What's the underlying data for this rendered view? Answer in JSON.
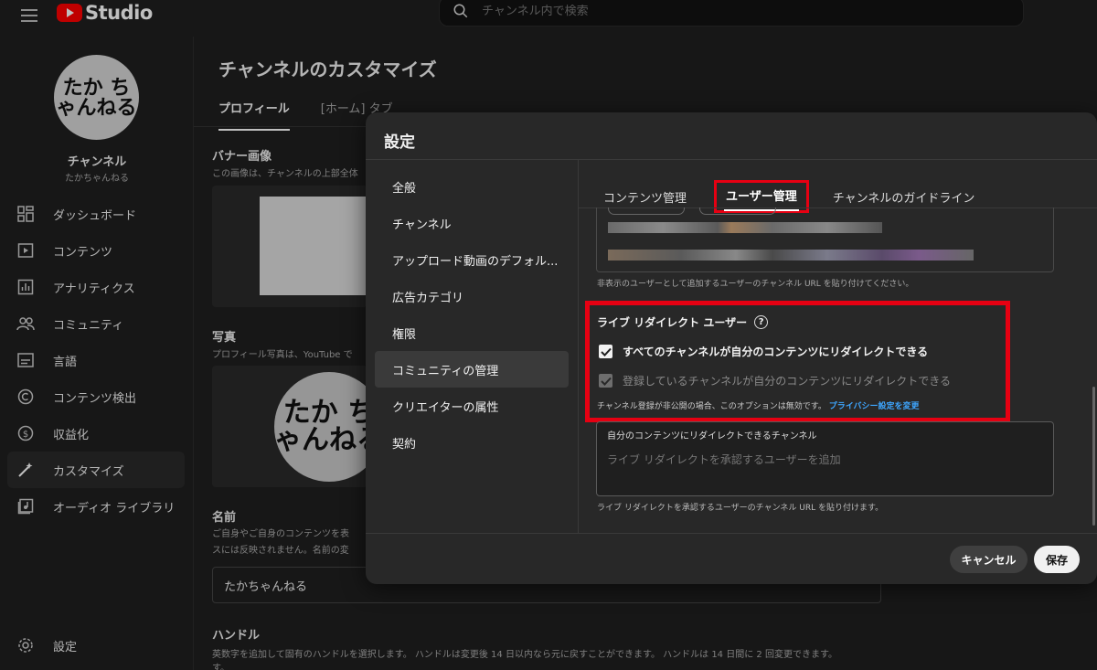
{
  "app": {
    "logo_text": "Studio",
    "search_placeholder": "チャンネル内で検索"
  },
  "sidebar": {
    "avatar_text": "たか ちゃんねる",
    "channel_title": "チャンネル",
    "channel_name": "たかちゃんねる",
    "items": [
      {
        "label": "ダッシュボード",
        "icon": "dashboard-icon"
      },
      {
        "label": "コンテンツ",
        "icon": "content-icon"
      },
      {
        "label": "アナリティクス",
        "icon": "analytics-icon"
      },
      {
        "label": "コミュニティ",
        "icon": "community-icon"
      },
      {
        "label": "言語",
        "icon": "subtitles-icon"
      },
      {
        "label": "コンテンツ検出",
        "icon": "copyright-icon"
      },
      {
        "label": "収益化",
        "icon": "dollar-icon"
      },
      {
        "label": "カスタマイズ",
        "icon": "magic-wand-icon",
        "active": true
      },
      {
        "label": "オーディオ ライブラリ",
        "icon": "audio-library-icon"
      }
    ],
    "settings_label": "設定"
  },
  "main": {
    "title": "チャンネルのカスタマイズ",
    "tabs": [
      "プロフィール",
      "[ホーム] タブ"
    ],
    "banner_label": "バナー画像",
    "banner_desc": "この画像は、チャンネルの上部全体",
    "photo_label": "写真",
    "photo_desc": "プロフィール写真は、YouTube で",
    "name_label": "名前",
    "name_desc_1": "ご自身やご自身のコンテンツを表",
    "name_desc_2": "スには反映されません。名前の変",
    "name_value": "たかちゃんねる",
    "handle_label": "ハンドル",
    "handle_desc": "英数字を追加して固有のハンドルを選択します。 ハンドルは変更後 14 日以内なら元に戻すことができます。 ハンドルは 14 日間に 2 回変更できます。",
    "handle_desc_2": "す。"
  },
  "modal": {
    "title": "設定",
    "nav": [
      {
        "label": "全般"
      },
      {
        "label": "チャンネル"
      },
      {
        "label": "アップロード動画のデフォル..."
      },
      {
        "label": "広告カテゴリ"
      },
      {
        "label": "権限"
      },
      {
        "label": "コミュニティの管理",
        "active": true
      },
      {
        "label": "クリエイターの属性"
      },
      {
        "label": "契約"
      }
    ],
    "tabs": {
      "content": "コンテンツ管理",
      "users": "ユーザー管理",
      "guidelines": "チャンネルのガイドライン"
    },
    "hidden_users_note": "非表示のユーザーとして追加するユーザーのチャンネル URL を貼り付けてください。",
    "live_redirect": {
      "heading": "ライブ リダイレクト ユーザー",
      "help": "?",
      "option_all": "すべてのチャンネルが自分のコンテンツにリダイレクトできる",
      "option_subscribed": "登録しているチャンネルが自分のコンテンツにリダイレクトできる",
      "note": "チャンネル登録が非公開の場合、このオプションは無効です。",
      "link": "プライバシー設定を変更"
    },
    "approve": {
      "title": "自分のコンテンツにリダイレクトできるチャンネル",
      "placeholder": "ライブ リダイレクトを承認するユーザーを追加",
      "note": "ライブ リダイレクトを承認するユーザーのチャンネル URL を貼り付けます。"
    },
    "cancel_label": "キャンセル",
    "save_label": "保存"
  },
  "colors": {
    "highlight": "#e60012",
    "link": "#3ea6ff",
    "brand": "#ff0000"
  }
}
